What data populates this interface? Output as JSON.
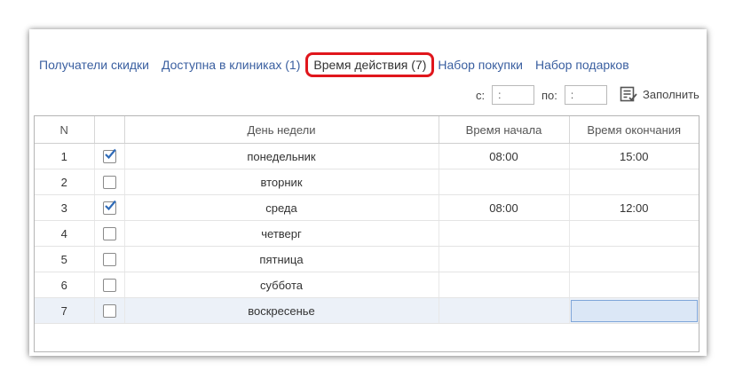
{
  "tabs": [
    {
      "label": "Получатели скидки",
      "active": false
    },
    {
      "label": "Доступна в клиниках (1)",
      "active": false
    },
    {
      "label": "Время действия (7)",
      "active": true
    },
    {
      "label": "Набор покупки",
      "active": false
    },
    {
      "label": "Набор подарков",
      "active": false
    }
  ],
  "filter": {
    "from_label": "с:",
    "from_value": ":",
    "to_label": "по:",
    "to_value": ":",
    "fill_label": "Заполнить"
  },
  "table": {
    "headers": {
      "n": "N",
      "check": "",
      "day": "День недели",
      "start": "Время начала",
      "end": "Время окончания"
    },
    "rows": [
      {
        "n": "1",
        "checked": true,
        "day": "понедельник",
        "start": "08:00",
        "end": "15:00"
      },
      {
        "n": "2",
        "checked": false,
        "day": "вторник",
        "start": "",
        "end": ""
      },
      {
        "n": "3",
        "checked": true,
        "day": "среда",
        "start": "08:00",
        "end": "12:00"
      },
      {
        "n": "4",
        "checked": false,
        "day": "четверг",
        "start": "",
        "end": ""
      },
      {
        "n": "5",
        "checked": false,
        "day": "пятница",
        "start": "",
        "end": ""
      },
      {
        "n": "6",
        "checked": false,
        "day": "суббота",
        "start": "",
        "end": ""
      },
      {
        "n": "7",
        "checked": false,
        "day": "воскресенье",
        "start": "",
        "end": "",
        "selected": true
      }
    ]
  },
  "colors": {
    "accent": "#3a5fa0",
    "highlight": "#e0161c",
    "selected_row": "#ecf1f8",
    "check": "#2f6bb8"
  }
}
